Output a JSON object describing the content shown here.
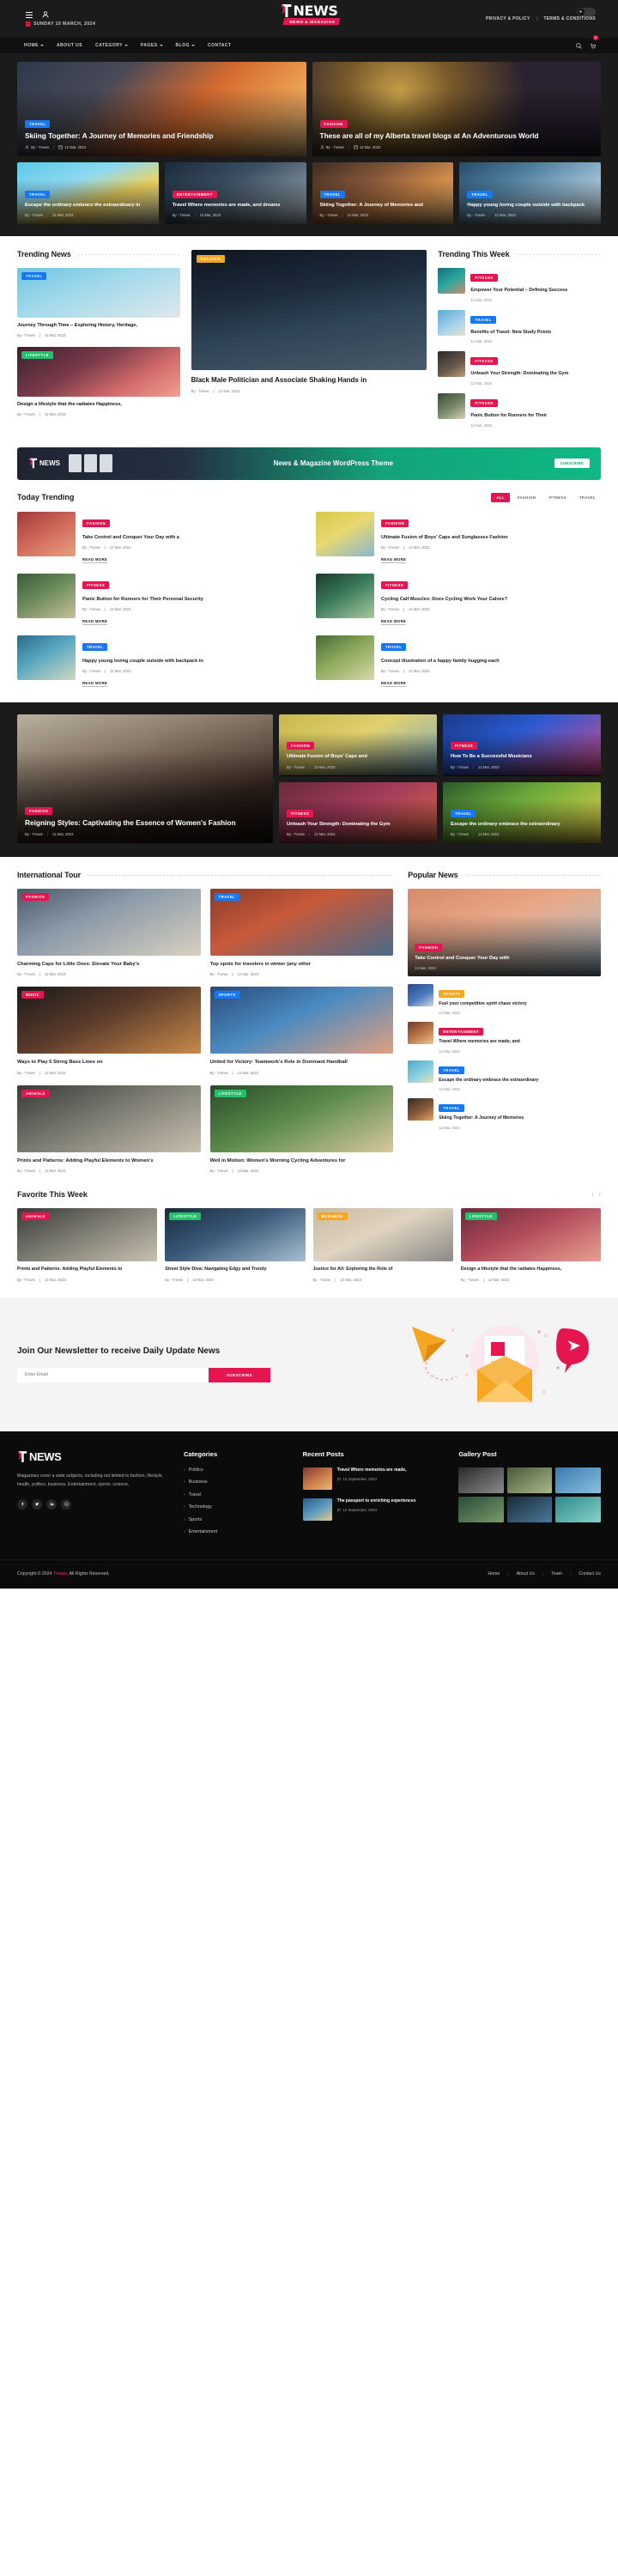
{
  "topbar": {
    "date": "SUNDAY 10 MARCH, 2024",
    "logo_word": "NEWS",
    "logo_sub": "NEWS & MAGAZINE",
    "links": [
      "PRIVACY & POLICY",
      "TERMS & CONDITIONS"
    ],
    "divider": "|"
  },
  "nav": {
    "items": [
      "HOME",
      "ABOUT US",
      "CATEGORY",
      "PAGES",
      "BLOG",
      "CONTACT"
    ],
    "has_caret": [
      true,
      false,
      true,
      true,
      true,
      false
    ],
    "cart_count": "0"
  },
  "hero": {
    "main": [
      {
        "tag": "TRAVEL",
        "tag_class": "t-travel",
        "title": "Skiing Together: A Journey of Memories and Friendship",
        "author": "By - Tnews",
        "date": "12 Mar, 2023"
      },
      {
        "tag": "FASHION",
        "tag_class": "t-fashion",
        "title": "These are all of my Alberta travel blogs at An Adventurous World",
        "author": "By - Tnews",
        "date": "12 Mar, 2023"
      }
    ],
    "small": [
      {
        "tag": "TRAVEL",
        "tag_class": "t-travel",
        "title": "Escape the ordinary embrace the extraordinary in",
        "author": "By - Tnews",
        "date": "12 Mar, 2023"
      },
      {
        "tag": "ENTERTAINMENT",
        "tag_class": "t-entertainment",
        "title": "Travel Where memories are made, and dreams",
        "author": "By - Tnews",
        "date": "12 Mar, 2023"
      },
      {
        "tag": "TRAVEL",
        "tag_class": "t-travel",
        "title": "Skiing Together: A Journey of Memories and",
        "author": "By - Tnews",
        "date": "12 Mar, 2023"
      },
      {
        "tag": "TRAVEL",
        "tag_class": "t-travel",
        "title": "Happy young loving couple outside with backpack",
        "author": "By - Tnews",
        "date": "12 Mar, 2023"
      }
    ]
  },
  "trending": {
    "title": "Trending News",
    "left": [
      {
        "tag": "TRAVEL",
        "tag_class": "t-travel",
        "title": "Journey Through Time – Exploring History, Heritage,",
        "author": "By - Tnews",
        "date": "12 Mar, 2023"
      },
      {
        "tag": "LIFESTYLE",
        "tag_class": "t-lifestyle",
        "title": "Design a lifestyle that the radiates Happiness,",
        "author": "By - Tnews",
        "date": "12 Mar, 2023"
      }
    ],
    "big": {
      "tag": "POLITICS",
      "tag_class": "t-politics",
      "title": "Black Male Politician and Associate Shaking Hands in",
      "author": "By - Tnews",
      "date": "12 Mar, 2023"
    },
    "week_title": "Trending This Week",
    "week": [
      {
        "tag": "FITNESS",
        "tag_class": "t-fitness",
        "title": "Empower Your Potential – Defining Success",
        "date": "12 Mar, 2023"
      },
      {
        "tag": "TRAVEL",
        "tag_class": "t-travel",
        "title": "Benefits of Travel: New Study Points",
        "date": "12 Mar, 2023"
      },
      {
        "tag": "FITNESS",
        "tag_class": "t-fitness",
        "title": "Unleash Your Strength: Dominating the Gym",
        "date": "12 Mar, 2023"
      },
      {
        "tag": "FITNESS",
        "tag_class": "t-fitness",
        "title": "Panic Button for Runners for Their",
        "date": "12 Mar, 2023"
      }
    ]
  },
  "promo": {
    "logo_word": "NEWS",
    "text": "News & Magazine WordPress Theme",
    "button": "SUBSCRIBE"
  },
  "today": {
    "title": "Today Trending",
    "tabs": [
      "ALL",
      "FASHION",
      "FITNESS",
      "TRAVEL"
    ],
    "active_tab": "ALL",
    "items": [
      {
        "tag": "FASHION",
        "tag_class": "t-fashion",
        "title": "Take Control and Conquer Your Day with a",
        "author": "By - Tnews",
        "date": "12 Mar, 2023",
        "read": "READ MORE"
      },
      {
        "tag": "FASHION",
        "tag_class": "t-fashion",
        "title": "Ultimate Fusion of Boys' Caps and Sunglasses Fashion",
        "author": "By - Tnews",
        "date": "12 Mar, 2023",
        "read": "READ MORE"
      },
      {
        "tag": "FITNESS",
        "tag_class": "t-fitness",
        "title": "Panic Button for Runners for Their Personal Security",
        "author": "By - Tnews",
        "date": "12 Mar, 2023",
        "read": "READ MORE"
      },
      {
        "tag": "FITNESS",
        "tag_class": "t-fitness",
        "title": "Cycling Calf Muscles: Does Cycling Work Your Calves?",
        "author": "By - Tnews",
        "date": "12 Mar, 2023",
        "read": "READ MORE"
      },
      {
        "tag": "TRAVEL",
        "tag_class": "t-travel",
        "title": "Happy young loving couple outside with backpack in",
        "author": "By - Tnews",
        "date": "12 Mar, 2023",
        "read": "READ MORE"
      },
      {
        "tag": "TRAVEL",
        "tag_class": "t-travel",
        "title": "Concept illustration of a happy family hugging each",
        "author": "By - Tnews",
        "date": "12 Mar, 2023",
        "read": "READ MORE"
      }
    ]
  },
  "fashion": {
    "main": {
      "tag": "FASHION",
      "tag_class": "t-fashion",
      "title": "Reigning Styles: Captivating the Essence of Women's Fashion",
      "author": "By - Tnews",
      "date": "12 Mar, 2023"
    },
    "cards": [
      {
        "tag": "FASHION",
        "tag_class": "t-fashion",
        "title": "Ultimate Fusion of Boys' Caps and",
        "author": "By - Tnews",
        "date": "12 Mar, 2023"
      },
      {
        "tag": "FITNESS",
        "tag_class": "t-fitness",
        "title": "How To Be a Successful Musicians",
        "author": "By - Tnews",
        "date": "12 Mar, 2023"
      },
      {
        "tag": "FITNESS",
        "tag_class": "t-fitness",
        "title": "Unleash Your Strength: Dominating the Gym",
        "author": "By - Tnews",
        "date": "12 Mar, 2023"
      },
      {
        "tag": "TRAVEL",
        "tag_class": "t-travel",
        "title": "Escape the ordinary embrace the extraordinary",
        "author": "By - Tnews",
        "date": "12 Mar, 2023"
      }
    ]
  },
  "intl": {
    "title": "International Tour",
    "items": [
      {
        "tag": "FASHION",
        "tag_class": "t-fashion",
        "title": "Charming Caps for Little Ones: Elevate Your Baby's",
        "author": "By - Tnews",
        "date": "12 Mar, 2023"
      },
      {
        "tag": "TRAVEL",
        "tag_class": "t-travel",
        "title": "Top spots for travelers in winter (any other",
        "author": "By - Tnews",
        "date": "12 Mar, 2023"
      },
      {
        "tag": "MUSIC",
        "tag_class": "t-fashion",
        "title": "Ways to Play 5 String Bass Lines on",
        "author": "By - Tnews",
        "date": "12 Mar, 2023"
      },
      {
        "tag": "SPORTS",
        "tag_class": "t-technology",
        "title": "United for Victory: Teamwork's Role in Dominant Handball",
        "author": "By - Tnews",
        "date": "12 Mar, 2023"
      },
      {
        "tag": "ANIMALS",
        "tag_class": "t-animals",
        "title": "Prints and Patterns: Adding Playful Elements to Women's",
        "author": "By - Tnews",
        "date": "12 Mar, 2023"
      },
      {
        "tag": "LIFESTYLE",
        "tag_class": "t-lifestyle",
        "title": "Well in Motion: Women's Morning Cycling Adventures for",
        "author": "By - Tnews",
        "date": "12 Mar, 2023"
      }
    ],
    "popular_title": "Popular News",
    "feature": {
      "tag": "FASHION",
      "tag_class": "t-fashion",
      "title": "Take Control and Conquer Your Day with",
      "date": "12 Mar, 2023"
    },
    "list": [
      {
        "tag": "SPORTS",
        "tag_class": "t-sports",
        "title": "Fuel your competitive spirit chase victory",
        "date": "12 Mar, 2023"
      },
      {
        "tag": "ENTERTAINMENT",
        "tag_class": "t-entertainment",
        "title": "Travel Where memories are made, and",
        "date": "12 Mar, 2023"
      },
      {
        "tag": "TRAVEL",
        "tag_class": "t-travel",
        "title": "Escape the ordinary embrace the extraordinary",
        "date": "12 Mar, 2023"
      },
      {
        "tag": "TRAVEL",
        "tag_class": "t-travel",
        "title": "Skiing Together: A Journey of Memories",
        "date": "12 Mar, 2023"
      }
    ]
  },
  "favorite": {
    "title": "Favorite This Week",
    "items": [
      {
        "tag": "ANIMALS",
        "tag_class": "t-animals",
        "title": "Prints and Patterns: Adding Playful Elements to",
        "author": "By - Tnews",
        "date": "12 Mar, 2023"
      },
      {
        "tag": "LIFESTYLE",
        "tag_class": "t-lifestyle",
        "title": "Street Style Diva: Navigating Edgy and Trendy",
        "author": "By - Tnews",
        "date": "12 Mar, 2023"
      },
      {
        "tag": "BUSINESS",
        "tag_class": "t-sports",
        "title": "Justice for All: Exploring the Role of",
        "author": "By - Tnews",
        "date": "12 Mar, 2023"
      },
      {
        "tag": "LIFESTYLE",
        "tag_class": "t-lifestyle",
        "title": "Design a lifestyle that the radiates Happiness,",
        "author": "By - Tnews",
        "date": "12 Mar, 2023"
      }
    ]
  },
  "newsletter": {
    "heading": "Join Our Newsletter to receive Daily Update News",
    "placeholder": "Enter Email",
    "button": "SUBSCRIBE"
  },
  "footer": {
    "logo_word": "NEWS",
    "description": "Magazines cover a wide subjects, including not limited to fashion, lifestyle, health, politics, business, Entertainment, sports, science,",
    "categories_title": "Categories",
    "categories": [
      "Politics",
      "Business",
      "Travel",
      "Technology",
      "Sports",
      "Entertainment"
    ],
    "recent_title": "Recent Posts",
    "recent": [
      {
        "title": "Travel Where memories are made,",
        "date": "12 September, 2023"
      },
      {
        "title": "The passport to enriching experiences",
        "date": "12 September, 2023"
      }
    ],
    "gallery_title": "Gallery Post",
    "copyright_pre": "Copyright © 2024 ",
    "copyright_brand": "Tnews",
    "copyright_post": ". All Rights Reserved.",
    "links": [
      "Home",
      "About Us",
      "Team",
      "Contact Us"
    ]
  }
}
